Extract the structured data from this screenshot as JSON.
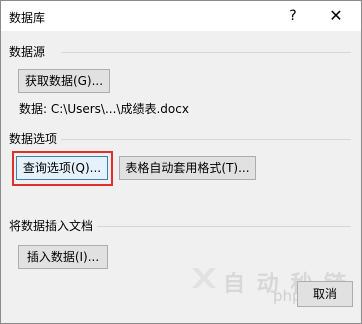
{
  "titlebar": {
    "title": "数据库",
    "help": "?",
    "close": "✕"
  },
  "datasource": {
    "heading": "数据源",
    "get_data_label": "获取数据(G)...",
    "path_text": "数据:  C:\\Users\\...\\成绩表.docx"
  },
  "options": {
    "heading": "数据选项",
    "query_label": "查询选项(Q)...",
    "autoformat_label": "表格自动套用格式(T)..."
  },
  "insert": {
    "heading": "将数据插入文档",
    "insert_label": "插入数据(I)..."
  },
  "footer": {
    "cancel_label": "取消"
  },
  "watermark": {
    "text": "自 动 秒 链",
    "php": "php"
  }
}
